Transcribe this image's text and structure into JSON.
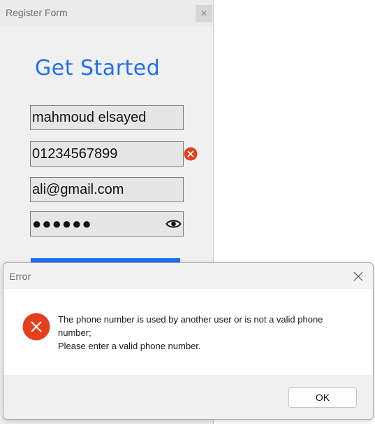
{
  "register_window": {
    "title": "Register Form",
    "close_glyph": "×",
    "heading": "Get Started",
    "fields": {
      "name": "mahmoud elsayed",
      "phone": "01234567899",
      "email": "ali@gmail.com",
      "password_mask": "●●●●●●"
    },
    "icons": {
      "phone_status": "error-icon",
      "password_toggle": "eye-icon"
    }
  },
  "error_dialog": {
    "title": "Error",
    "message_line1": "The phone number is used by another user or is not a valid phone number;",
    "message_line2": "Please enter a valid phone number.",
    "ok_label": "OK",
    "icons": {
      "status": "error-icon",
      "close": "close-icon"
    }
  },
  "colors": {
    "accent": "#1e6ff5",
    "error": "#e4401d",
    "window_bg": "#f0f0f0",
    "field_bg": "#e6e6e6"
  }
}
